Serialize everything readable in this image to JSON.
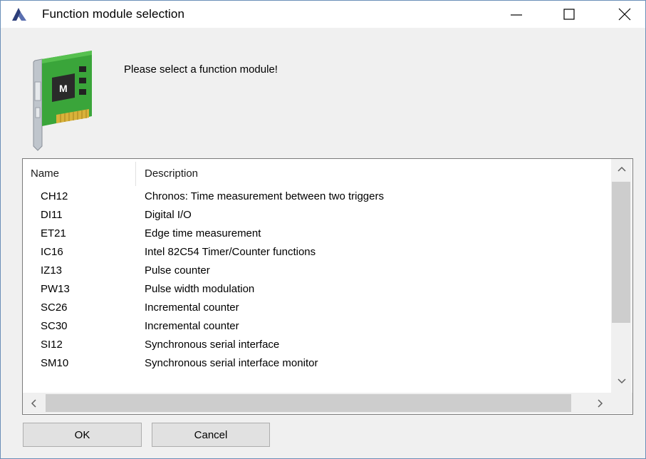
{
  "window": {
    "title": "Function module selection",
    "controls": {
      "minimize": "minimize-icon",
      "maximize": "maximize-icon",
      "close": "close-icon"
    }
  },
  "prompt": "Please select a function module!",
  "list": {
    "columns": [
      "Name",
      "Description"
    ],
    "rows": [
      {
        "name": "CH12",
        "description": "Chronos: Time measurement between two triggers"
      },
      {
        "name": "DI11",
        "description": "Digital I/O"
      },
      {
        "name": "ET21",
        "description": "Edge time measurement"
      },
      {
        "name": "IC16",
        "description": "Intel 82C54 Timer/Counter functions"
      },
      {
        "name": "IZ13",
        "description": "Pulse counter"
      },
      {
        "name": "PW13",
        "description": "Pulse width modulation"
      },
      {
        "name": "SC26",
        "description": "Incremental counter"
      },
      {
        "name": "SC30",
        "description": "Incremental counter"
      },
      {
        "name": "SI12",
        "description": "Synchronous serial interface"
      },
      {
        "name": "SM10",
        "description": "Synchronous serial interface monitor"
      }
    ]
  },
  "buttons": {
    "ok": "OK",
    "cancel": "Cancel"
  },
  "colors": {
    "accent": "#1e3a8a",
    "board": "#3aa53a",
    "frame": "#6b8fb8"
  }
}
